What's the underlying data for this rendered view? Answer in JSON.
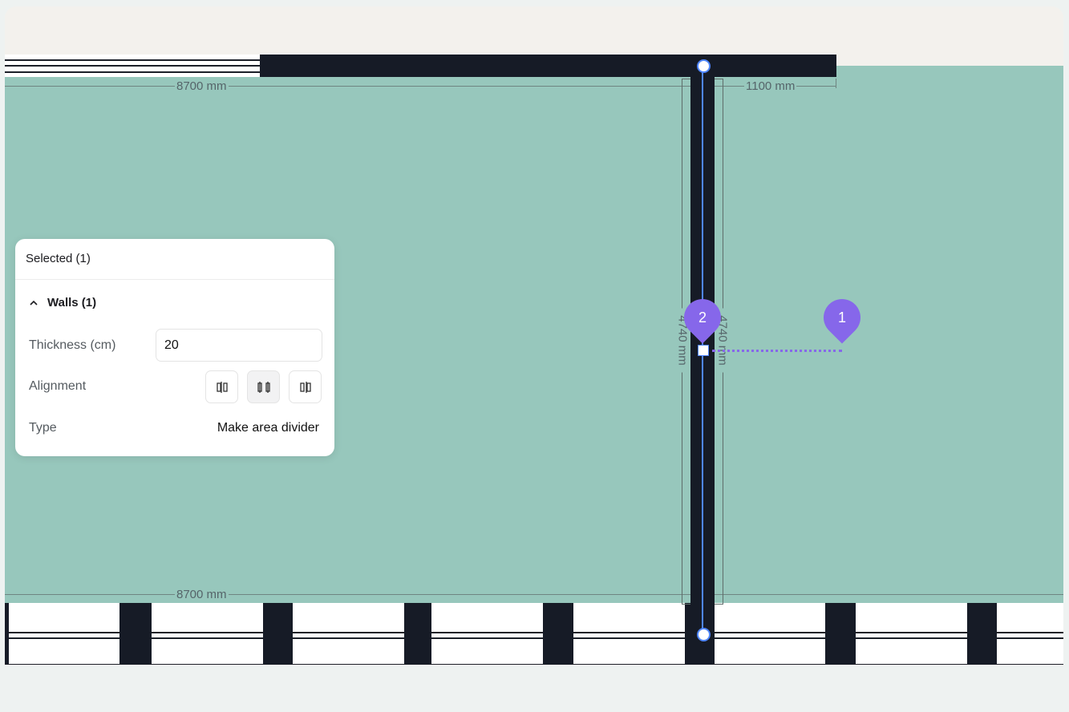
{
  "colors": {
    "floor": "#97c7bc",
    "wall": "#161b26",
    "accent_purple": "#8667ea",
    "selection_blue": "#4f86ff",
    "outer_bg": "#f3f1ed",
    "bottom_bg": "#eef2f1"
  },
  "dimensions": {
    "top_left": "8700 mm",
    "top_right": "1100 mm",
    "bottom_left": "8700 mm",
    "vertical_left": "4740 mm",
    "vertical_right": "4740 mm"
  },
  "markers": {
    "pin_1": "1",
    "pin_2": "2"
  },
  "panel": {
    "header": "Selected (1)",
    "section_title": "Walls (1)",
    "section_chevron": "chevron-up-icon",
    "thickness_label": "Thickness (cm)",
    "thickness_value": "20",
    "alignment_label": "Alignment",
    "alignment_options": [
      "align-left-icon",
      "align-center-icon",
      "align-right-icon"
    ],
    "alignment_selected": "align-center-icon",
    "type_label": "Type",
    "type_action": "Make area divider"
  }
}
